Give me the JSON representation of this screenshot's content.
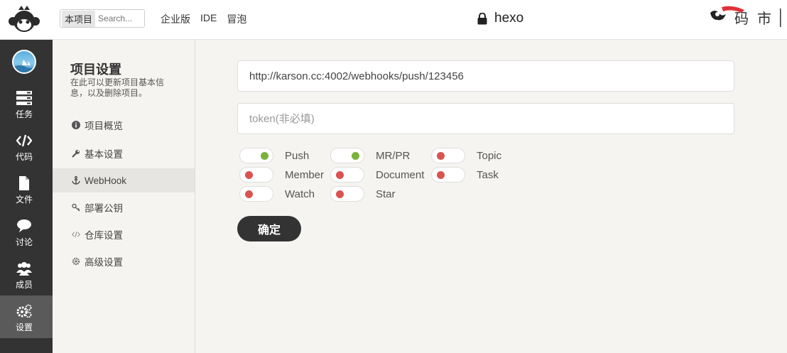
{
  "header": {
    "search_scope": "本项目",
    "search_placeholder": "Search...",
    "nav": [
      "企业版",
      "IDE",
      "冒泡"
    ],
    "project_name": "hexo"
  },
  "sidebar": {
    "items": [
      {
        "label": "任务",
        "icon": "tasks-icon"
      },
      {
        "label": "代码",
        "icon": "code-icon"
      },
      {
        "label": "文件",
        "icon": "file-icon"
      },
      {
        "label": "讨论",
        "icon": "comments-icon"
      },
      {
        "label": "成员",
        "icon": "users-icon"
      },
      {
        "label": "设置",
        "icon": "settings-icon",
        "active": true
      }
    ]
  },
  "settings": {
    "title": "项目设置",
    "description": "在此可以更新项目基本信息，以及删除项目。",
    "items": [
      {
        "label": "项目概览",
        "icon": "info-icon"
      },
      {
        "label": "基本设置",
        "icon": "wrench-icon"
      },
      {
        "label": "WebHook",
        "icon": "anchor-icon",
        "active": true
      },
      {
        "label": "部署公钥",
        "icon": "key-icon"
      },
      {
        "label": "仓库设置",
        "icon": "code-icon"
      },
      {
        "label": "高级设置",
        "icon": "gear-icon"
      }
    ]
  },
  "webhook": {
    "url_value": "http://karson.cc:4002/webhooks/push/123456",
    "token_placeholder": "token(非必填)",
    "events": [
      {
        "label": "Push",
        "enabled": true
      },
      {
        "label": "MR/PR",
        "enabled": true
      },
      {
        "label": "Topic",
        "enabled": false
      },
      {
        "label": "Member",
        "enabled": false
      },
      {
        "label": "Document",
        "enabled": false
      },
      {
        "label": "Task",
        "enabled": false
      },
      {
        "label": "Watch",
        "enabled": false
      },
      {
        "label": "Star",
        "enabled": false
      }
    ],
    "submit_label": "确定"
  },
  "colors": {
    "toggle_on": "#7ab33c",
    "toggle_off": "#d9534f",
    "sidebar_bg": "#333333"
  }
}
